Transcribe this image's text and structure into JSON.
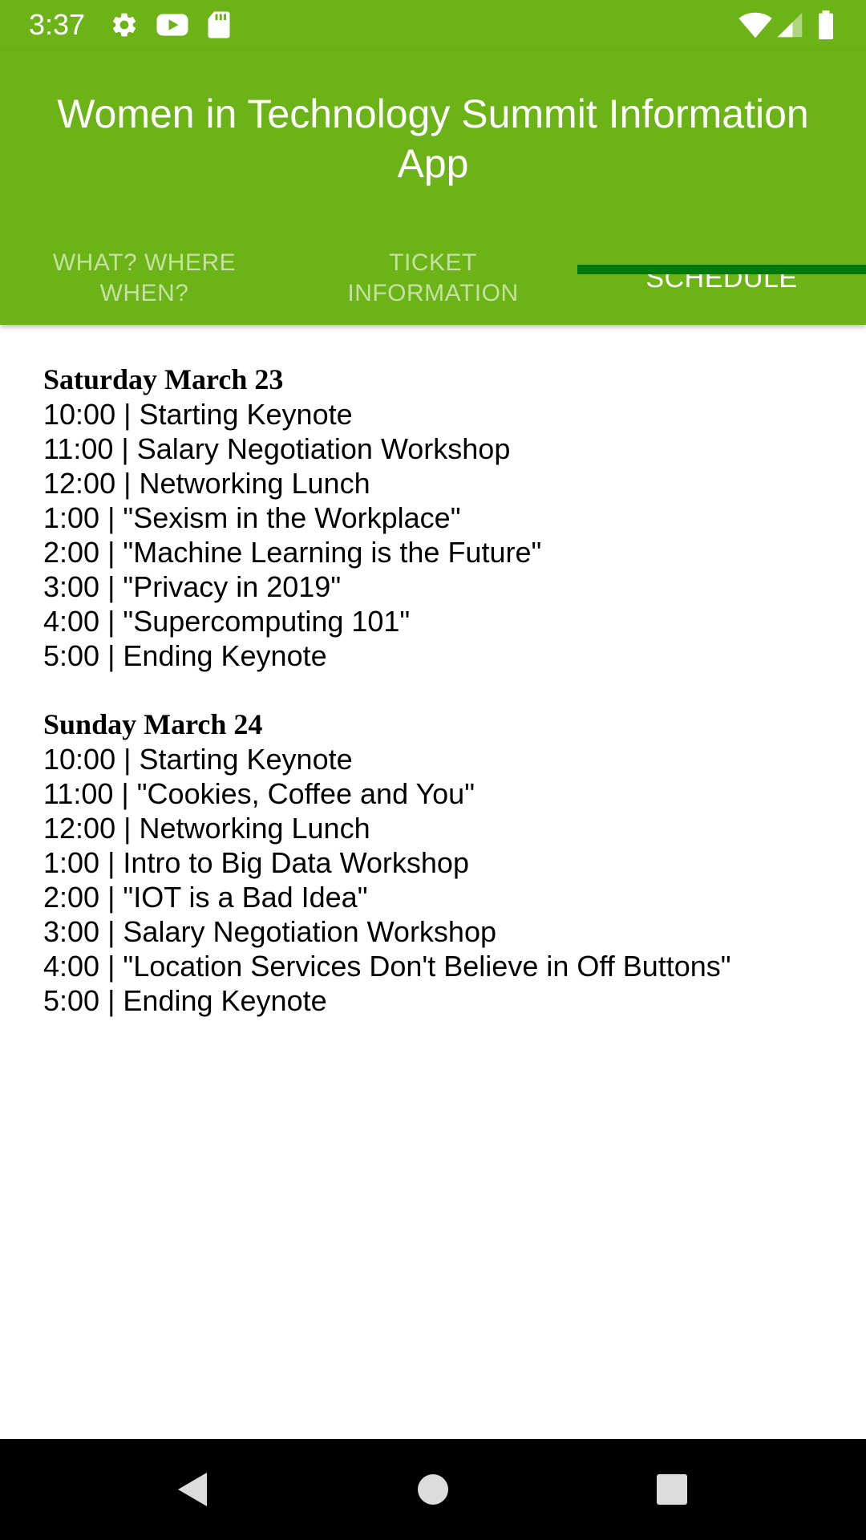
{
  "status_bar": {
    "time": "3:37",
    "icons": [
      "gear-icon",
      "youtube-icon",
      "sd-card-icon",
      "wifi-icon",
      "signal-icon",
      "battery-icon"
    ]
  },
  "app_bar": {
    "title": "Women in Technology Summit Information App",
    "background": "#6cb317",
    "tabs": [
      {
        "label": "WHAT? WHERE WHEN?",
        "selected": false
      },
      {
        "label": "TICKET INFORMATION",
        "selected": false
      },
      {
        "label": "SCHEDULE",
        "selected": true
      }
    ],
    "indicator_color": "#007a0f"
  },
  "schedule": {
    "days": [
      {
        "heading": "Saturday March 23",
        "events": [
          "10:00 | Starting Keynote",
          "11:00 | Salary Negotiation Workshop",
          "12:00 | Networking Lunch",
          "1:00 | \"Sexism in the Workplace\"",
          "2:00 | \"Machine Learning is the Future\"",
          "3:00 | \"Privacy in 2019\"",
          "4:00 | \"Supercomputing 101\"",
          "5:00 | Ending Keynote"
        ]
      },
      {
        "heading": "Sunday March 24",
        "events": [
          "10:00 | Starting Keynote",
          "11:00 | \"Cookies, Coffee and You\"",
          "12:00 | Networking Lunch",
          "1:00 | Intro to Big Data Workshop",
          "2:00 | \"IOT is a Bad Idea\"",
          "3:00 | Salary Negotiation Workshop",
          "4:00 | \"Location Services Don't Believe in Off Buttons\"",
          "5:00 | Ending Keynote"
        ]
      }
    ]
  },
  "nav_bar": {
    "buttons": [
      "back-icon",
      "home-icon",
      "recents-icon"
    ]
  }
}
